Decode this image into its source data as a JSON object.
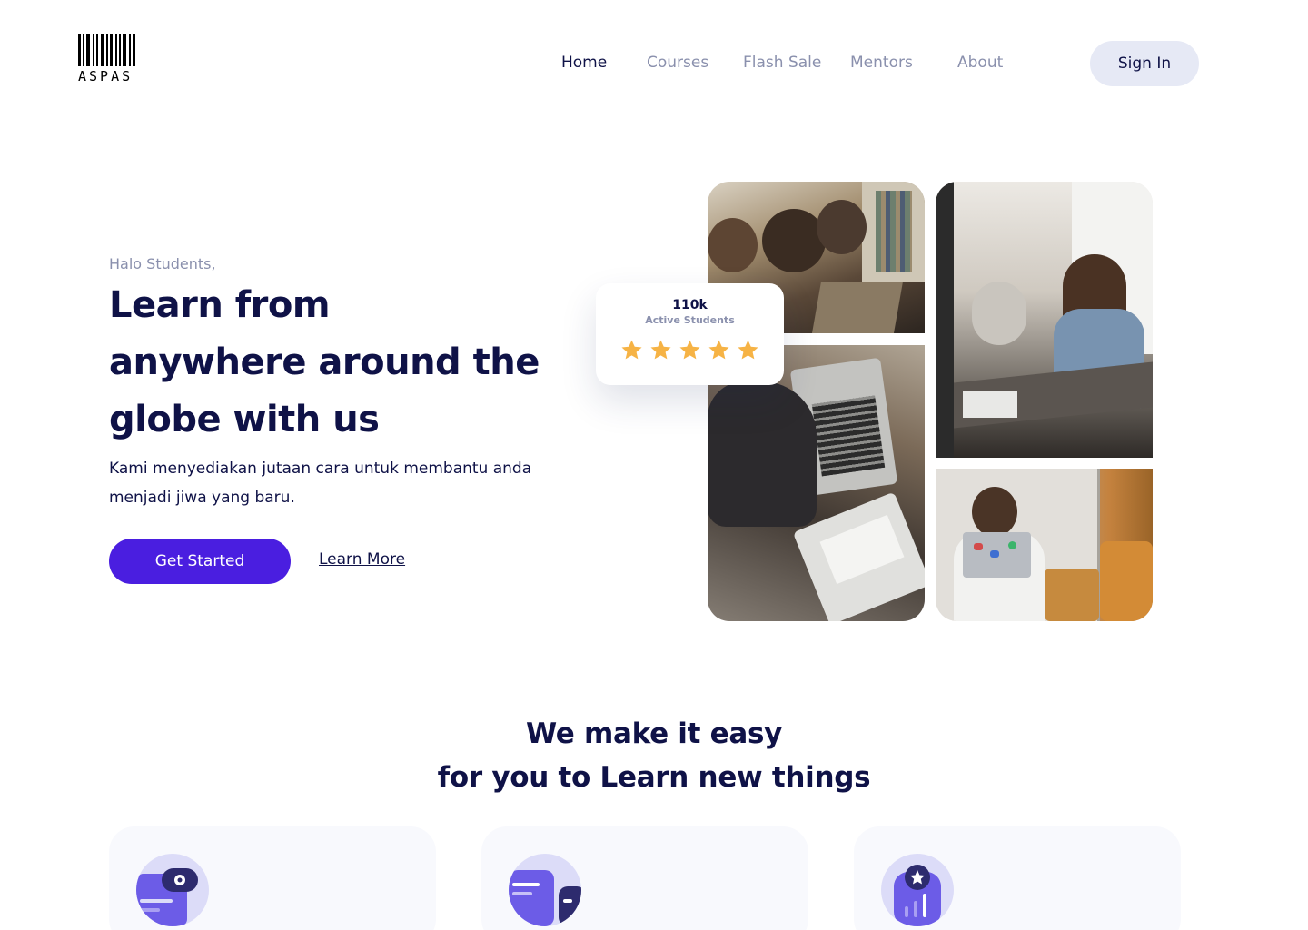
{
  "brand": {
    "name": "ASPAS"
  },
  "nav": {
    "items": [
      {
        "label": "Home",
        "active": true
      },
      {
        "label": "Courses",
        "active": false
      },
      {
        "label": "Flash Sale",
        "active": false
      },
      {
        "label": "Mentors",
        "active": false
      },
      {
        "label": "About",
        "active": false
      }
    ],
    "signin_label": "Sign In"
  },
  "hero": {
    "greeting": "Halo Students,",
    "headline": {
      "part1": "Learn ",
      "highlight1": "from",
      "highlight2": "anywhere",
      "part2": " around the globe with us"
    },
    "subtext": "Kami menyediakan jutaan cara untuk membantu anda menjadi jiwa yang baru.",
    "cta_primary": "Get Started",
    "cta_secondary": "Learn More"
  },
  "stats": {
    "value": "110k",
    "label": "Active Students",
    "rating": 5
  },
  "features": {
    "title_line1": "We make it easy",
    "title_line2": "for you to Learn new things",
    "cards": [
      {
        "icon": "video-course-icon"
      },
      {
        "icon": "chat-icon"
      },
      {
        "icon": "progress-badge-icon"
      }
    ]
  },
  "colors": {
    "primary": "#4a1ee0",
    "navy": "#0f1247",
    "muted": "#8a90ad",
    "highlight": "#1aa3f2",
    "star": "#f6b345",
    "icon_purple": "#6c5ce7"
  }
}
